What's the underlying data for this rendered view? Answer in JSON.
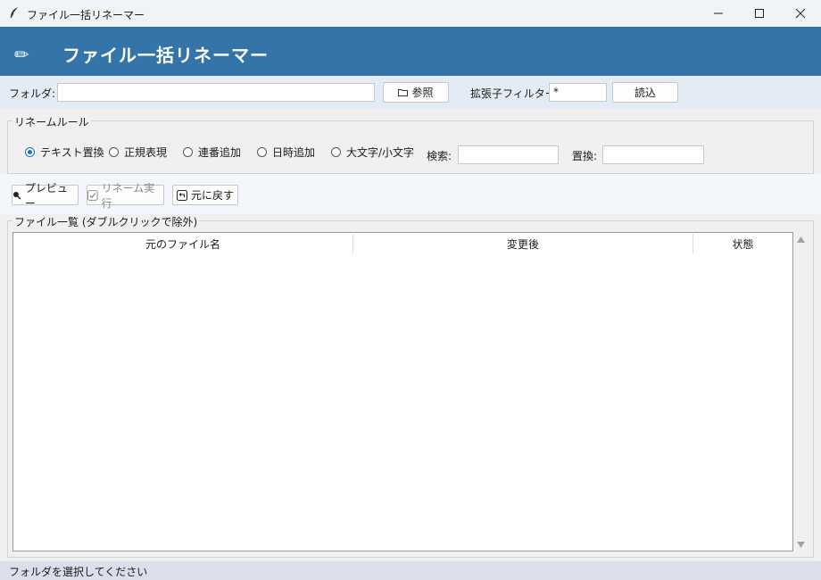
{
  "window": {
    "title": "ファイル一括リネーマー",
    "minimize_glyph": "—",
    "maximize_glyph": "☐",
    "close_glyph": "✕"
  },
  "header": {
    "icon": "pencil-icon",
    "icon_glyph": "✏",
    "title": "ファイル一括リネーマー",
    "background": "#3574a8"
  },
  "folder_row": {
    "folder_label": "フォルダ:",
    "folder_value": "",
    "browse_label": "参照",
    "browse_icon": "folder-icon",
    "ext_filter_label": "拡張子フィルター:",
    "ext_filter_value": "*",
    "load_label": "読込"
  },
  "rename_rules": {
    "group_title": "リネームルール",
    "options": [
      {
        "label": "テキスト置換",
        "selected": true
      },
      {
        "label": "正規表現",
        "selected": false
      },
      {
        "label": "連番追加",
        "selected": false
      },
      {
        "label": "日時追加",
        "selected": false
      },
      {
        "label": "大文字/小文字",
        "selected": false
      }
    ],
    "search_label": "検索:",
    "search_value": "",
    "replace_label": "置換:",
    "replace_value": ""
  },
  "actions": {
    "preview_label": "プレビュー",
    "preview_icon": "magnifier-icon",
    "rename_label": "リネーム実行",
    "rename_icon": "checkbox-icon",
    "rename_enabled": false,
    "undo_label": "元に戻す",
    "undo_icon": "undo-icon"
  },
  "file_list": {
    "group_title": "ファイル一覧 (ダブルクリックで除外)",
    "columns": [
      "元のファイル名",
      "変更後",
      "状態"
    ],
    "rows": []
  },
  "status": {
    "text": "フォルダを選択してください"
  }
}
